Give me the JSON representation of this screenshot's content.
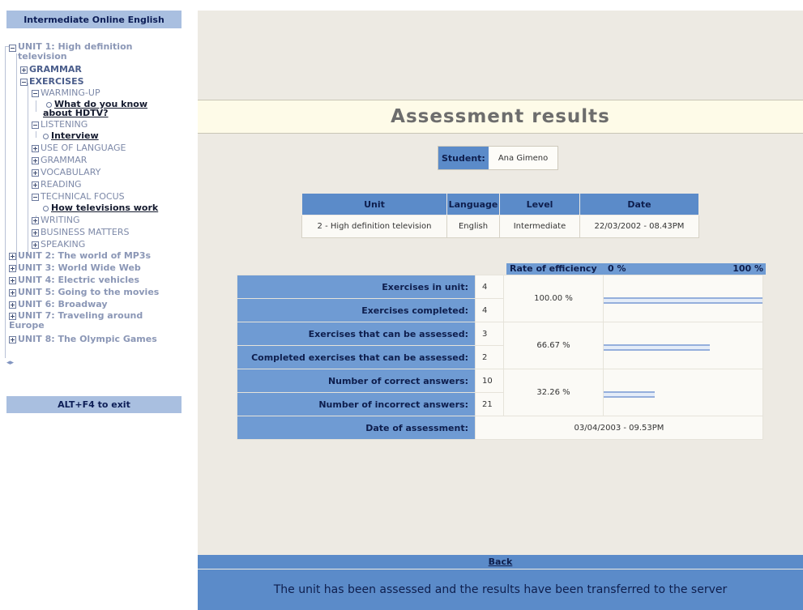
{
  "sidebar": {
    "title": "Intermediate Online English",
    "exit_label": "ALT+F4 to exit",
    "arrows": "◂▸",
    "tree": {
      "unit1": "UNIT 1: High definition television",
      "grammar": "GRAMMAR",
      "exercises": "EXERCISES",
      "warming_up": "WARMING-UP",
      "what_do_you_know": "What do you know about HDTV?",
      "listening": "LISTENING",
      "interview": "Interview",
      "use_of_language": "USE OF LANGUAGE",
      "grammar2": "GRAMMAR",
      "vocabulary": "VOCABULARY",
      "reading": "READING",
      "technical_focus": "TECHNICAL FOCUS",
      "how_televisions_work": "How televisions work",
      "writing": "WRITING",
      "business_matters": "BUSINESS MATTERS",
      "speaking": "SPEAKING",
      "unit2": "UNIT 2: The world of MP3s",
      "unit3": "UNIT 3: World Wide Web",
      "unit4": "UNIT 4: Electric vehicles",
      "unit5": "UNIT 5: Going to the movies",
      "unit6": "UNIT 6: Broadway",
      "unit7": "UNIT 7: Traveling around Europe",
      "unit8": "UNIT 8: The Olympic Games"
    }
  },
  "main": {
    "title": "Assessment results",
    "student_label": "Student:",
    "student_name": "Ana Gimeno",
    "unit_table": {
      "headers": [
        "Unit",
        "Language",
        "Level",
        "Date"
      ],
      "row": [
        "2 - High definition television",
        "English",
        "Intermediate",
        "22/03/2002 - 08.43PM"
      ]
    },
    "rate": {
      "label": "Rate of efficiency",
      "min": "0 %",
      "max": "100 %"
    },
    "stats": {
      "ex_in_unit_label": "Exercises in unit:",
      "ex_in_unit": "4",
      "ex_completed_label": "Exercises completed:",
      "ex_completed": "4",
      "pct1": "100.00 %",
      "pct1_value": 100.0,
      "ex_assessable_label": "Exercises that can be assessed:",
      "ex_assessable": "3",
      "completed_assessable_label": "Completed exercises that can be assessed:",
      "completed_assessable": "2",
      "pct2": "66.67 %",
      "pct2_value": 66.67,
      "correct_label": "Number of correct answers:",
      "correct": "10",
      "incorrect_label": "Number of incorrect answers:",
      "incorrect": "21",
      "pct3": "32.26 %",
      "pct3_value": 32.26,
      "date_label": "Date of assessment:",
      "date": "03/04/2003 - 09.53PM"
    },
    "back_label": "Back",
    "status_message": "The unit has been assessed and the results have been transferred to the server"
  },
  "colors": {
    "header_blue": "#5b8bc9",
    "sidebar_header": "#a9bfe0",
    "main_bg": "#edeae3",
    "title_bg": "#fefbe8"
  }
}
